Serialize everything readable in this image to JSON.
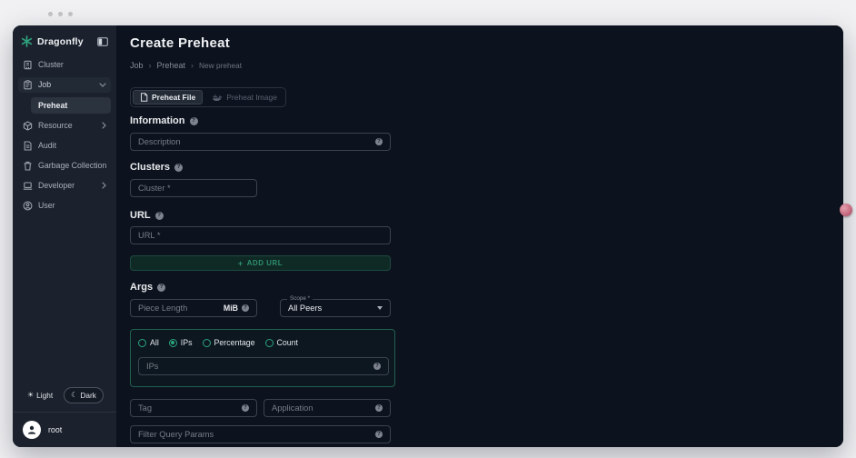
{
  "colors": {
    "accent_green": "#2ba47c",
    "sidebar_bg": "#1b222d",
    "main_bg": "#0d131e",
    "badge_pink": "#c4677d"
  },
  "icons": {
    "help": "?",
    "plus": "+",
    "breadcrumb_sep": "›",
    "sun": "☀",
    "moon": "☾"
  },
  "sidebar": {
    "logo_label": "Dragonfly",
    "items": [
      {
        "label": "Cluster"
      },
      {
        "label": "Job"
      },
      {
        "label": "Preheat"
      },
      {
        "label": "Resource"
      },
      {
        "label": "Audit"
      },
      {
        "label": "Garbage Collection"
      },
      {
        "label": "Developer"
      },
      {
        "label": "User"
      }
    ],
    "theme": {
      "light_label": "Light",
      "dark_label": "Dark",
      "selected": "Dark"
    },
    "user": {
      "name": "root"
    }
  },
  "header": {
    "title": "Create Preheat",
    "breadcrumb": [
      "Job",
      "Preheat",
      "New preheat"
    ]
  },
  "tabs": [
    {
      "label": "Preheat File",
      "selected": true
    },
    {
      "label": "Preheat Image",
      "selected": false
    }
  ],
  "form": {
    "information": {
      "heading": "Information",
      "description_placeholder": "Description"
    },
    "clusters": {
      "heading": "Clusters",
      "cluster_placeholder": "Cluster *"
    },
    "url": {
      "heading": "URL",
      "url_placeholder": "URL *",
      "add_button_label": "ADD URL"
    },
    "args": {
      "heading": "Args",
      "piece_length_placeholder": "Piece Length",
      "piece_length_unit": "MiB",
      "scope_label": "Scope *",
      "scope_value": "All Peers",
      "radios": [
        {
          "label": "All",
          "selected": false
        },
        {
          "label": "IPs",
          "selected": true
        },
        {
          "label": "Percentage",
          "selected": false
        },
        {
          "label": "Count",
          "selected": false
        }
      ],
      "ips_placeholder": "IPs",
      "tag_placeholder": "Tag",
      "application_placeholder": "Application",
      "filter_placeholder": "Filter Query Params"
    }
  }
}
